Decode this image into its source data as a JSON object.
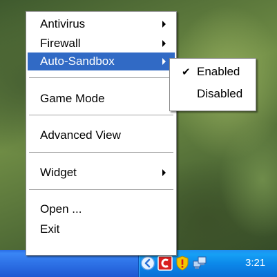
{
  "menu": {
    "items": [
      {
        "label": "Antivirus",
        "submenu": true
      },
      {
        "label": "Firewall",
        "submenu": true
      },
      {
        "label": "Auto-Sandbox",
        "submenu": true,
        "highlighted": true
      },
      {
        "label": "Game Mode",
        "submenu": false
      },
      {
        "label": "Advanced View",
        "submenu": false
      },
      {
        "label": "Widget",
        "submenu": true
      },
      {
        "label": "Open ...",
        "submenu": false
      },
      {
        "label": "Exit",
        "submenu": false
      }
    ]
  },
  "submenu": {
    "items": [
      {
        "label": "Enabled",
        "checked": true
      },
      {
        "label": "Disabled",
        "checked": false
      }
    ],
    "check_glyph": "✔"
  },
  "taskbar": {
    "clock": "3:21",
    "tray_icons": [
      "chevron-left-icon",
      "comodo-icon",
      "security-shield-icon",
      "network-icon"
    ]
  },
  "colors": {
    "highlight": "#316ac5",
    "taskbar": "#2f74e8",
    "tray": "#0b86e8"
  }
}
